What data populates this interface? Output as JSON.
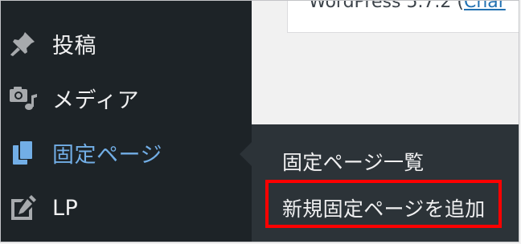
{
  "sidebar": {
    "items": [
      {
        "label": "投稿",
        "icon": "pushpin-icon"
      },
      {
        "label": "メディア",
        "icon": "media-icon"
      },
      {
        "label": "固定ページ",
        "icon": "pages-icon",
        "current": true
      },
      {
        "label": "LP",
        "icon": "edit-page-icon"
      }
    ]
  },
  "content": {
    "notice_prefix": "WordPress 5.7.2 (",
    "notice_link": "Char"
  },
  "submenu": {
    "items": [
      {
        "label": "固定ページ一覧"
      },
      {
        "label": "新規固定ページを追加",
        "highlighted": true
      }
    ]
  },
  "colors": {
    "sidebar_bg": "#1d2327",
    "submenu_bg": "#2c3338",
    "current_text": "#72aee6",
    "menu_text": "#f0f0f1",
    "highlight_border": "#ff0000",
    "content_bg": "#f1f1f1"
  }
}
